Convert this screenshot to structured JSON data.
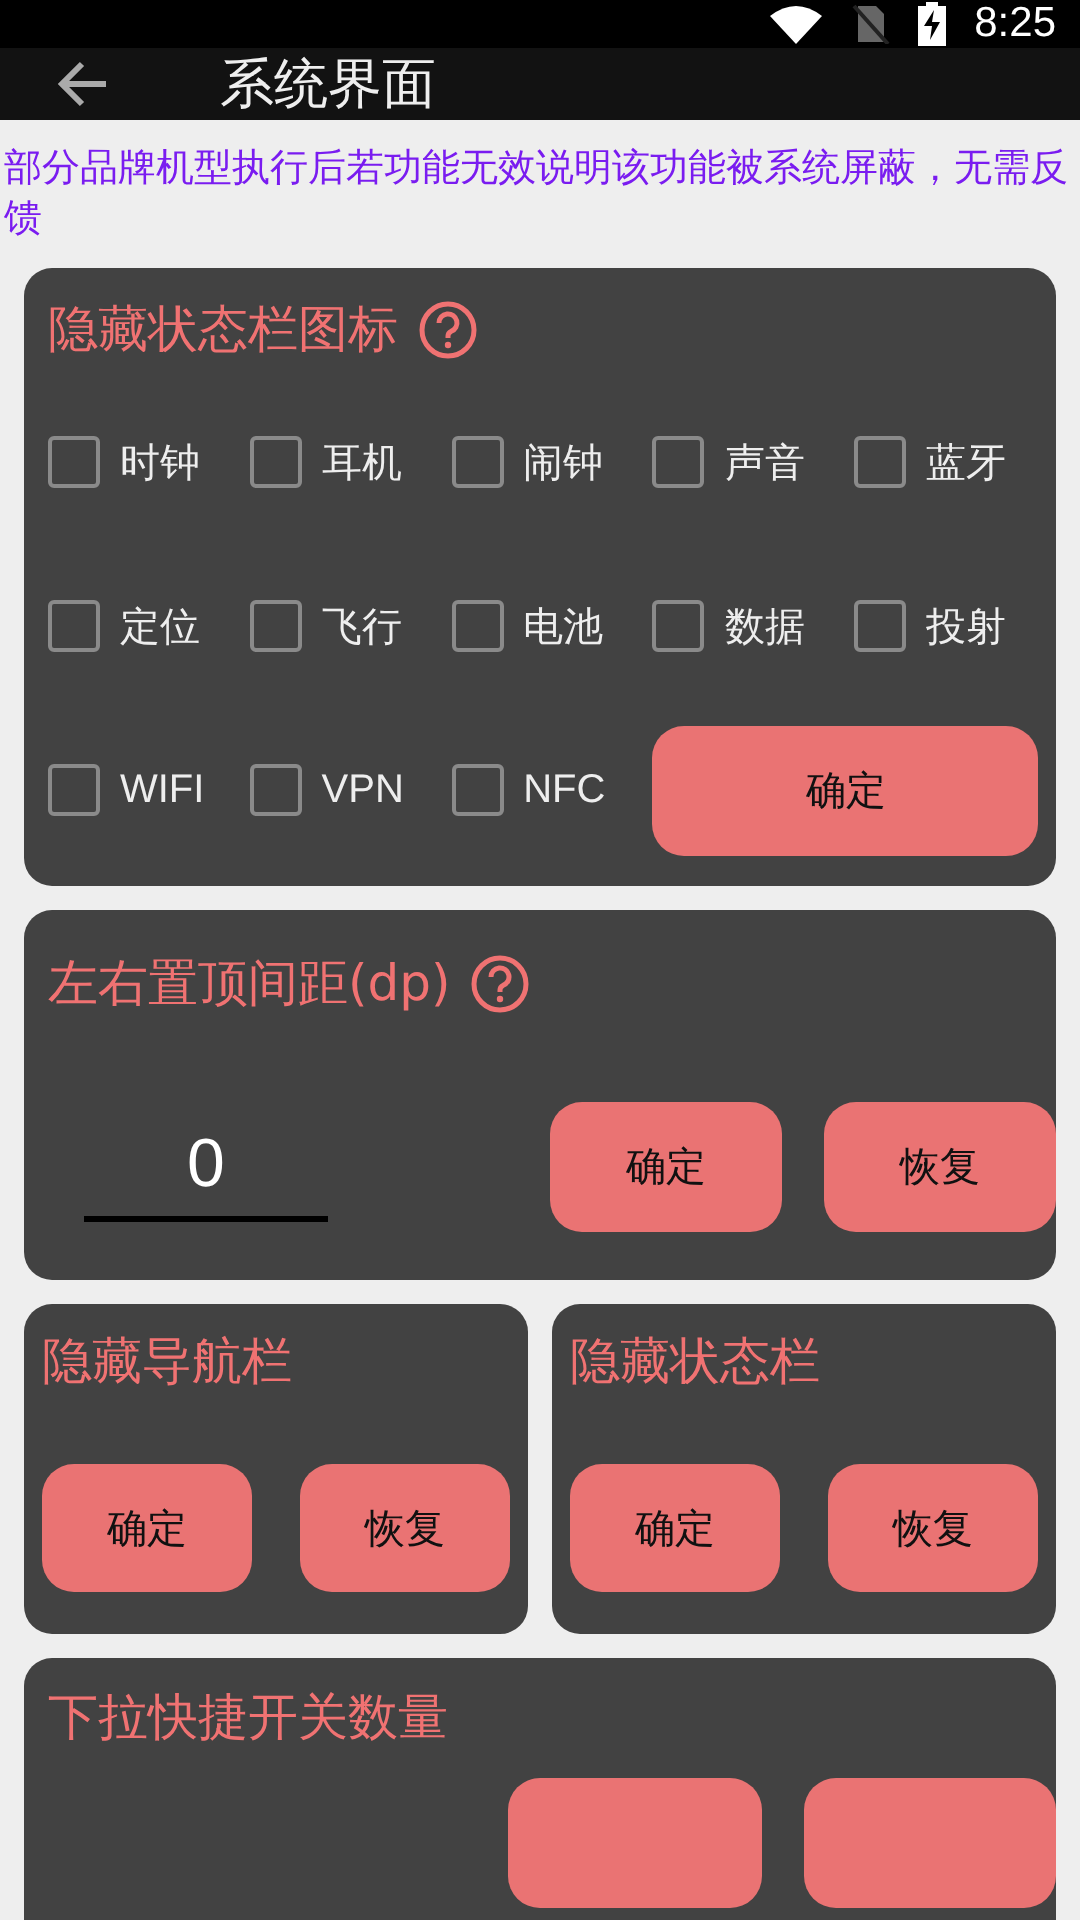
{
  "status_bar": {
    "time": "8:25"
  },
  "app_bar": {
    "title": "系统界面"
  },
  "notice": "部分品牌机型执行后若功能无效说明该功能被系统屏蔽，无需反馈",
  "status_icons_card": {
    "title": "隐藏状态栏图标",
    "options": [
      {
        "label": "时钟",
        "checked": false
      },
      {
        "label": "耳机",
        "checked": false
      },
      {
        "label": "闹钟",
        "checked": false
      },
      {
        "label": "声音",
        "checked": false
      },
      {
        "label": "蓝牙",
        "checked": false
      },
      {
        "label": "定位",
        "checked": false
      },
      {
        "label": "飞行",
        "checked": false
      },
      {
        "label": "电池",
        "checked": false
      },
      {
        "label": "数据",
        "checked": false
      },
      {
        "label": "投射",
        "checked": false
      },
      {
        "label": "WIFI",
        "checked": false
      },
      {
        "label": "VPN",
        "checked": false
      },
      {
        "label": "NFC",
        "checked": false
      }
    ],
    "confirm": "确定"
  },
  "margin_card": {
    "title": "左右置顶间距(dp)",
    "value": "0",
    "buttons": [
      "确定",
      "恢复"
    ]
  },
  "bar_cards": [
    {
      "title": "隐藏导航栏",
      "buttons": [
        "确定",
        "恢复"
      ]
    },
    {
      "title": "隐藏状态栏",
      "buttons": [
        "确定",
        "恢复"
      ]
    }
  ],
  "quick_card": {
    "title": "下拉快捷开关数量"
  }
}
